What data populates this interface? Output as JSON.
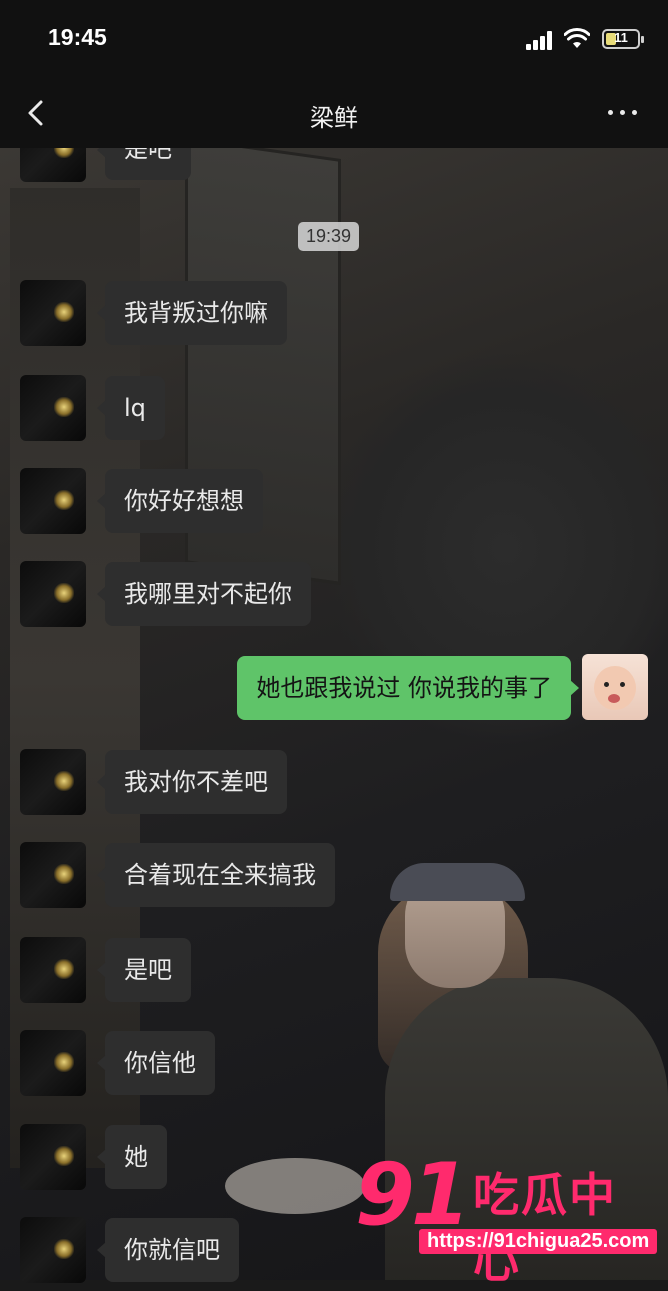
{
  "status_bar": {
    "time": "19:45",
    "battery_level": "11",
    "icons": [
      "signal-icon",
      "wifi-icon",
      "battery-icon"
    ]
  },
  "nav": {
    "title": "梁鲜",
    "back_icon": "chevron-left-icon",
    "more_icon": "more-dots-icon"
  },
  "chat": {
    "timestamp": "19:39",
    "partial_top_message": "是吧",
    "messages": [
      {
        "side": "left",
        "text": "我背叛过你嘛"
      },
      {
        "side": "left",
        "text": "lq"
      },
      {
        "side": "left",
        "text": "你好好想想"
      },
      {
        "side": "left",
        "text": "我哪里对不起你"
      },
      {
        "side": "right",
        "text": "她也跟我说过 你说我的事了"
      },
      {
        "side": "left",
        "text": "我对你不差吧"
      },
      {
        "side": "left",
        "text": "合着现在全来搞我"
      },
      {
        "side": "left",
        "text": "是吧"
      },
      {
        "side": "left",
        "text": "你信他"
      },
      {
        "side": "left",
        "text": "她"
      },
      {
        "side": "left",
        "text": "你就信吧"
      }
    ]
  },
  "watermark": {
    "number": "91",
    "brand": "吃瓜中心",
    "url": "https://91chigua25.com"
  },
  "colors": {
    "outgoing_bubble": "#5fc469",
    "incoming_bubble": "#2e2e2e",
    "watermark": "#ff2a6d"
  }
}
